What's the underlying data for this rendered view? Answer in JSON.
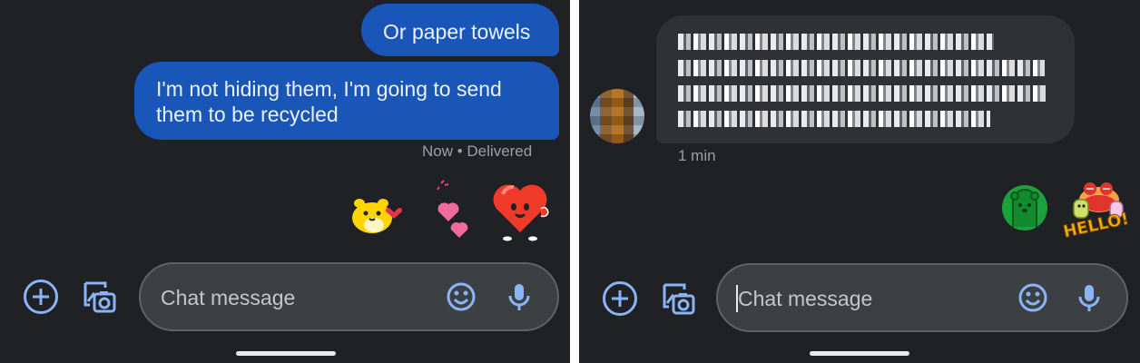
{
  "left_panel": {
    "messages": [
      {
        "text": "Or paper towels",
        "direction": "outgoing"
      },
      {
        "text_line1": "I'm not hiding them, I'm going to send",
        "text_line2": "them to be recycled",
        "direction": "outgoing"
      }
    ],
    "status": "Now • Delivered",
    "stickers": [
      "yellow-hamster-sticker",
      "pink-hearts-sticker",
      "red-heart-waving-sticker"
    ],
    "composer": {
      "placeholder": "Chat message"
    }
  },
  "right_panel": {
    "incoming_message_status": "1 min",
    "stickers": [
      "green-bear-sticker",
      "hello-sticker"
    ],
    "hello_text": "HELLO!",
    "composer": {
      "placeholder": "Chat message"
    }
  },
  "colors": {
    "background": "#202124",
    "outgoing_bubble": "#1a56b8",
    "incoming_bubble": "#303134",
    "accent": "#8ab4f8",
    "composer": "#3c4043"
  },
  "icons": [
    "plus-icon",
    "gallery-icon",
    "emoji-icon",
    "mic-icon"
  ]
}
